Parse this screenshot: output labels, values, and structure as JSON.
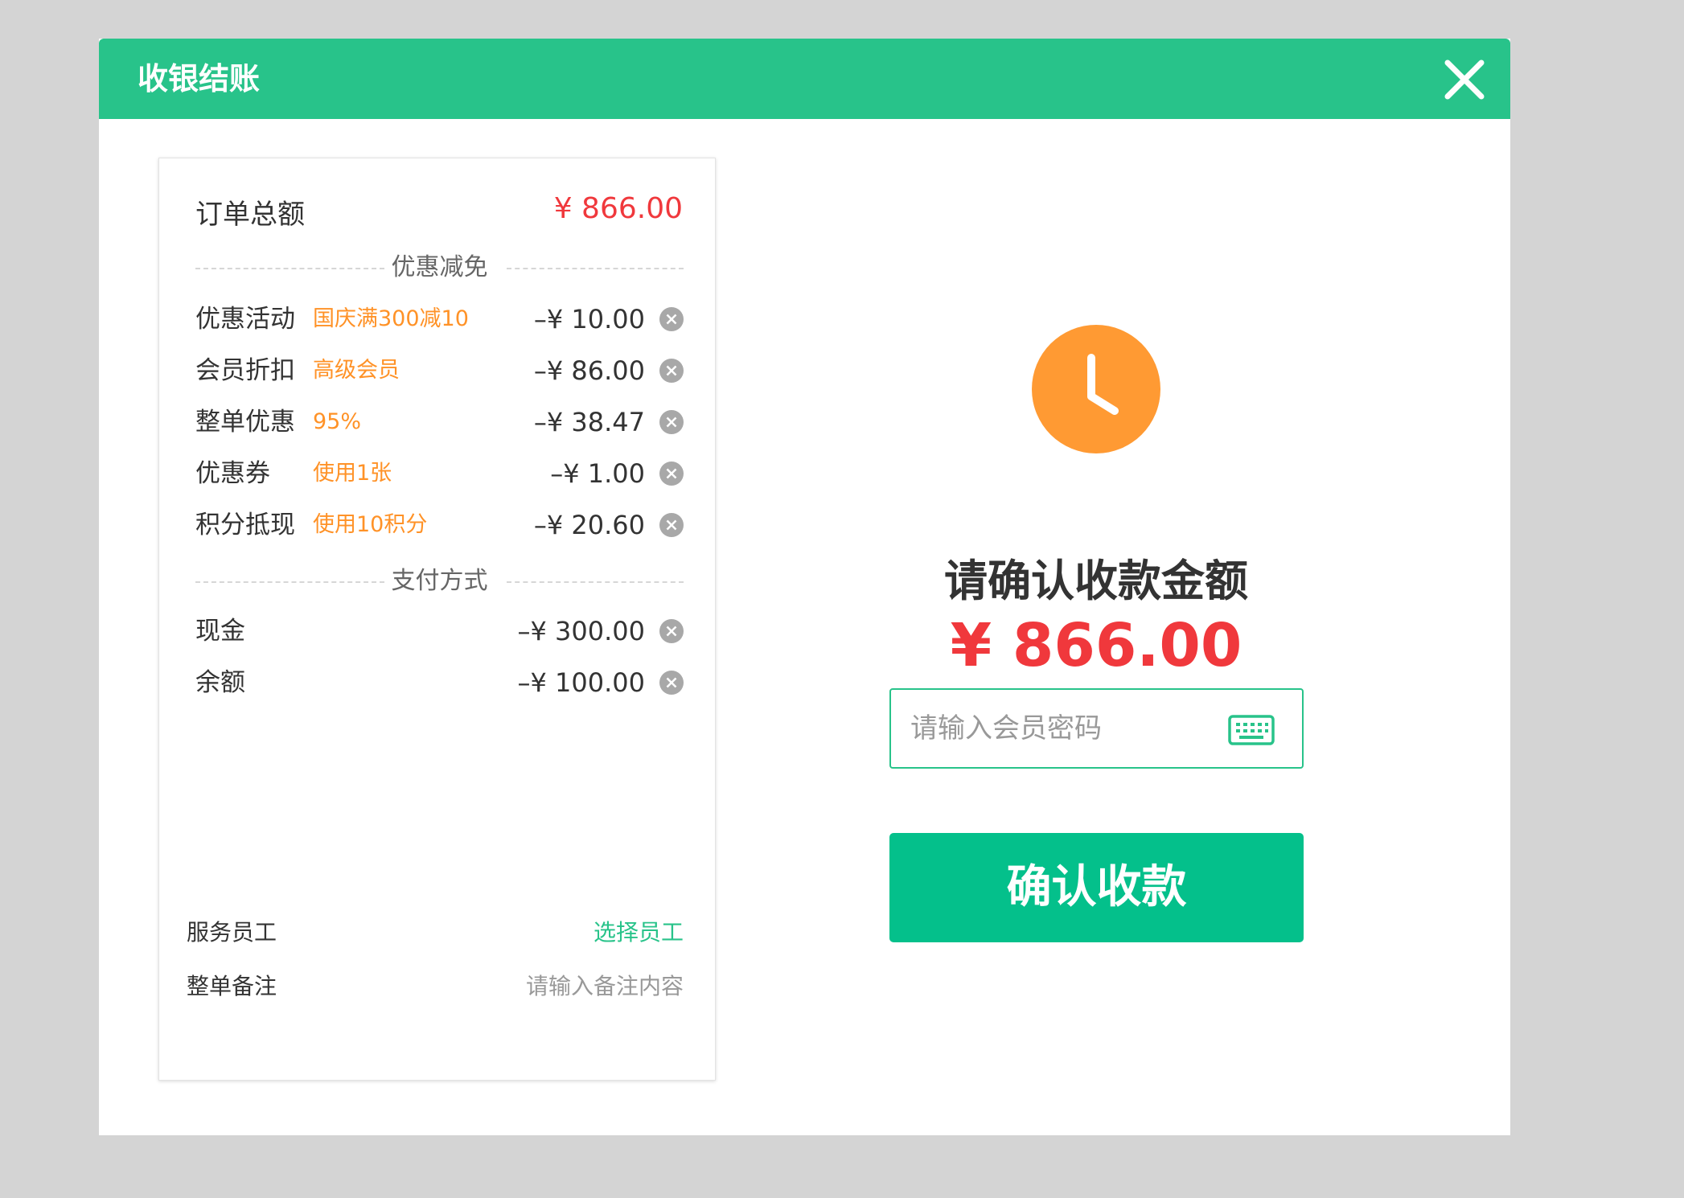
{
  "dialog": {
    "title": "收银结账",
    "close_icon": "close-icon"
  },
  "colors": {
    "accent": "#28c38a",
    "button": "#04c08b",
    "amount_red": "#f0383c",
    "tag_orange": "#ff9227",
    "clock_orange": "#ff9a33"
  },
  "summary": {
    "total_label": "订单总额",
    "total_value": "¥ 866.00",
    "discount_section": "优惠减免",
    "discounts": [
      {
        "label": "优惠活动",
        "tag": "国庆满300减10",
        "amount": "–¥ 10.00"
      },
      {
        "label": "会员折扣",
        "tag": "高级会员",
        "amount": "–¥ 86.00"
      },
      {
        "label": "整单优惠",
        "tag": "95%",
        "amount": "–¥ 38.47"
      },
      {
        "label": "优惠券",
        "tag": "使用1张",
        "amount": "–¥ 1.00"
      },
      {
        "label": "积分抵现",
        "tag": "使用10积分",
        "amount": "–¥ 20.60"
      }
    ],
    "payment_section": "支付方式",
    "payments": [
      {
        "label": "现金",
        "amount": "–¥ 300.00"
      },
      {
        "label": "余额",
        "amount": "–¥ 100.00"
      }
    ],
    "staff_label": "服务员工",
    "staff_link": "选择员工",
    "remark_label": "整单备注",
    "remark_placeholder": "请输入备注内容"
  },
  "confirm": {
    "status_icon": "clock-icon",
    "title": "请确认收款金额",
    "amount": "¥ 866.00",
    "password_placeholder": "请输入会员密码",
    "password_value": "",
    "keyboard_icon": "keyboard-icon",
    "button_label": "确认收款"
  }
}
